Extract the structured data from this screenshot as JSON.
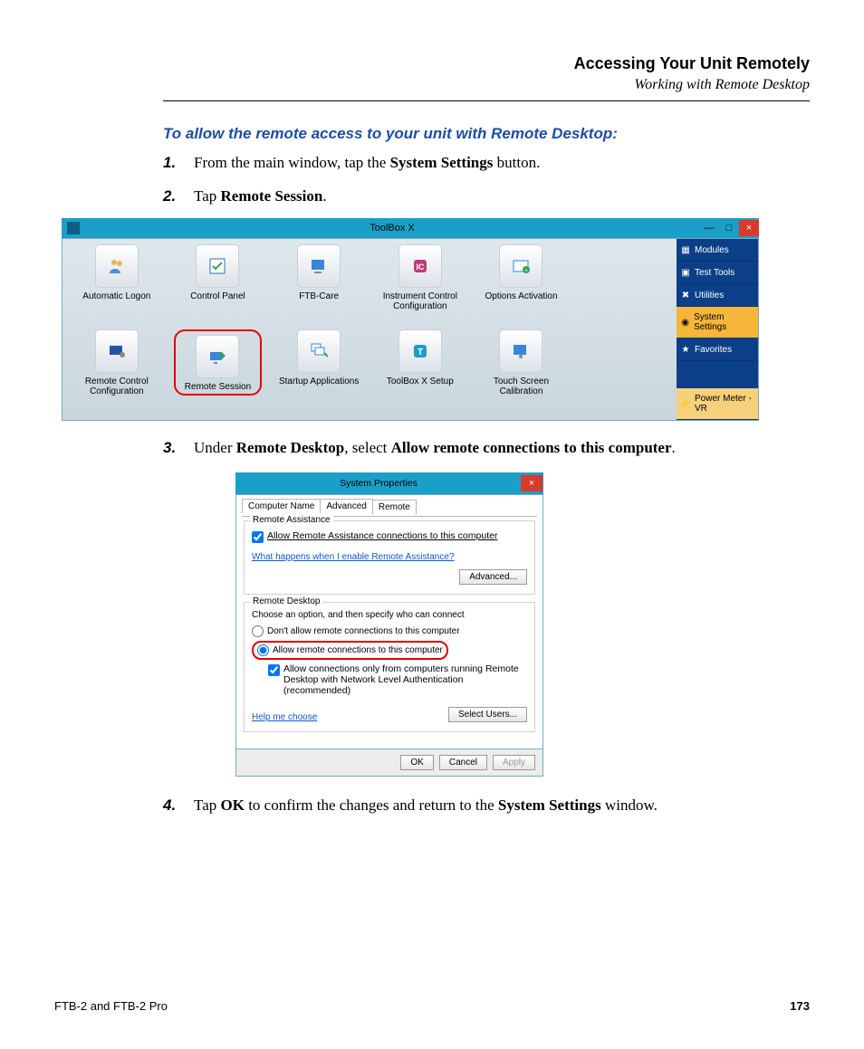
{
  "header": {
    "chapter": "Accessing Your Unit Remotely",
    "section": "Working with Remote Desktop"
  },
  "instr_title": "To allow the remote access to your unit with Remote Desktop:",
  "steps": {
    "s1": {
      "num": "1.",
      "pre": "From the main window, tap the ",
      "bold": "System Settings",
      "post": " button."
    },
    "s2": {
      "num": "2.",
      "pre": "Tap ",
      "bold": "Remote Session",
      "post": "."
    },
    "s3": {
      "num": "3.",
      "pre": "Under ",
      "b1": "Remote Desktop",
      "mid": ", select ",
      "b2": "Allow remote connections to this computer",
      "post": "."
    },
    "s4": {
      "num": "4.",
      "pre": "Tap ",
      "b1": "OK",
      "mid": " to confirm the changes and return to the ",
      "b2": "System Settings",
      "post": " window."
    }
  },
  "toolbox": {
    "title": "ToolBox X",
    "win_min": "—",
    "win_max": "□",
    "win_close": "×",
    "tiles": [
      {
        "label": "Automatic Logon"
      },
      {
        "label": "Control Panel"
      },
      {
        "label": "FTB-Care"
      },
      {
        "label": "Instrument Control Configuration"
      },
      {
        "label": "Options Activation"
      },
      {
        "label": ""
      },
      {
        "label": "Remote Control Configuration"
      },
      {
        "label": "Remote Session",
        "highlight": true
      },
      {
        "label": "Startup Applications"
      },
      {
        "label": "ToolBox X Setup"
      },
      {
        "label": "Touch Screen Calibration"
      },
      {
        "label": ""
      }
    ],
    "side": [
      {
        "label": "Modules"
      },
      {
        "label": "Test Tools"
      },
      {
        "label": "Utilities"
      },
      {
        "label": "System Settings",
        "selected": true
      },
      {
        "label": "Favorites"
      }
    ],
    "side_pm": "Power Meter - VR"
  },
  "sysprops": {
    "title": "System Properties",
    "tabs": {
      "t1": "Computer Name",
      "t2": "Advanced",
      "t3": "Remote"
    },
    "ra": {
      "legend": "Remote Assistance",
      "chk": "Allow Remote Assistance connections to this computer",
      "link": "What happens when I enable Remote Assistance?",
      "advanced": "Advanced..."
    },
    "rd": {
      "legend": "Remote Desktop",
      "choice_text": "Choose an option, and then specify who can connect",
      "opt_no": "Don't allow remote connections to this computer",
      "opt_yes": "Allow remote connections to this computer",
      "nla": "Allow connections only from computers running Remote Desktop with Network Level Authentication (recommended)",
      "help": "Help me choose",
      "select_users": "Select Users..."
    },
    "btns": {
      "ok": "OK",
      "cancel": "Cancel",
      "apply": "Apply"
    }
  },
  "footer": {
    "left": "FTB-2 and FTB-2 Pro",
    "page": "173"
  }
}
